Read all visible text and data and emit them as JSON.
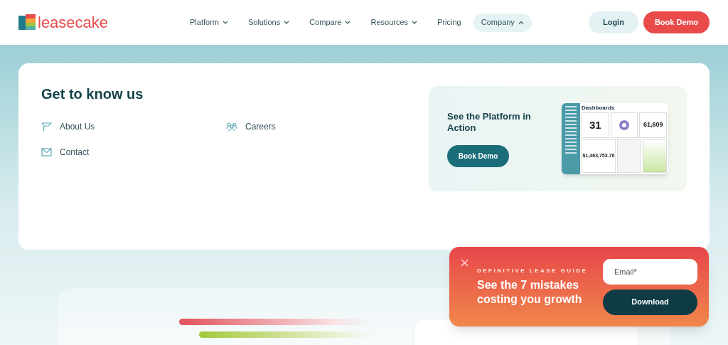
{
  "logo": {
    "text": "leasecake"
  },
  "nav": [
    {
      "label": "Platform",
      "has_menu": true,
      "expanded": false
    },
    {
      "label": "Solutions",
      "has_menu": true,
      "expanded": false
    },
    {
      "label": "Compare",
      "has_menu": true,
      "expanded": false
    },
    {
      "label": "Resources",
      "has_menu": true,
      "expanded": false
    },
    {
      "label": "Pricing",
      "has_menu": false,
      "expanded": false
    },
    {
      "label": "Company",
      "has_menu": true,
      "expanded": true
    }
  ],
  "header_buttons": {
    "login": "Login",
    "demo": "Book Demo"
  },
  "menu": {
    "title": "Get to know us",
    "links": [
      {
        "label": "About Us",
        "kind": "flag"
      },
      {
        "label": "Careers",
        "kind": "people"
      },
      {
        "label": "Contact",
        "kind": "mail"
      }
    ],
    "promo": {
      "title": "See the Platform in Action",
      "button": "Book Demo",
      "preview": {
        "title": "Dashboards",
        "tiles": [
          "31",
          "61,609",
          "$1,463,753.76"
        ]
      }
    }
  },
  "popup": {
    "eyebrow": "DEFINITIVE LEASE GUIDE",
    "headline": "See the 7 mistakes costing you growth",
    "email": {
      "placeholder": "Email*"
    },
    "button": "Download"
  }
}
